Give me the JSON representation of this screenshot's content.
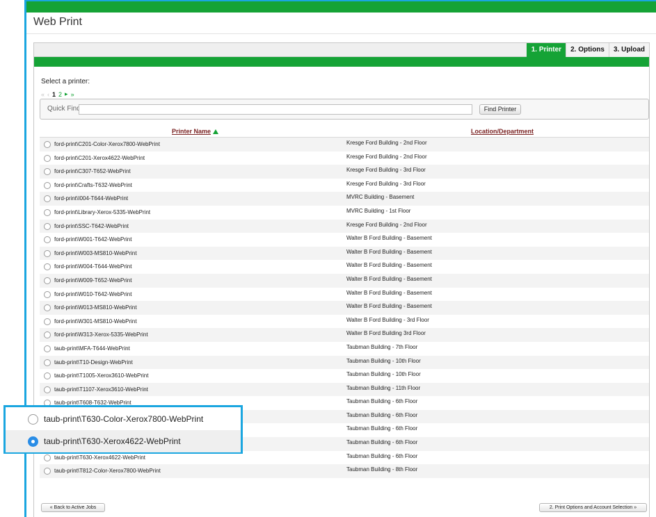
{
  "app": {
    "title": "Web Print"
  },
  "tabs": [
    {
      "label": "1. Printer",
      "active": true
    },
    {
      "label": "2. Options",
      "active": false
    },
    {
      "label": "3. Upload",
      "active": false
    }
  ],
  "select_label": "Select a printer:",
  "pager": {
    "first": "«",
    "prev": "‹",
    "current": "1",
    "next_page": "2",
    "next": "▸",
    "last": "»"
  },
  "quick_find": {
    "label": "Quick Find:",
    "value": "",
    "placeholder": "",
    "button": "Find Printer"
  },
  "table": {
    "columns": [
      "Printer Name",
      "Location/Department"
    ],
    "sort_column": "Printer Name",
    "rows": [
      {
        "name": "ford-print\\C201-Color-Xerox7800-WebPrint",
        "location": "Kresge Ford Building - 2nd Floor"
      },
      {
        "name": "ford-print\\C201-Xerox4622-WebPrint",
        "location": "Kresge Ford Building - 2nd Floor"
      },
      {
        "name": "ford-print\\C307-T652-WebPrint",
        "location": "Kresge Ford Building - 3rd Floor"
      },
      {
        "name": "ford-print\\Crafts-T632-WebPrint",
        "location": "Kresge Ford Building - 3rd Floor"
      },
      {
        "name": "ford-print\\I004-T644-WebPrint",
        "location": "MVRC Building - Basement"
      },
      {
        "name": "ford-print\\Library-Xerox-5335-WebPrint",
        "location": "MVRC Building - 1st Floor"
      },
      {
        "name": "ford-print\\SSC-T642-WebPrint",
        "location": "Kresge Ford Building - 2nd Floor"
      },
      {
        "name": "ford-print\\W001-T642-WebPrint",
        "location": "Walter B Ford Building - Basement"
      },
      {
        "name": "ford-print\\W003-MS810-WebPrint",
        "location": "Walter B Ford Building - Basement"
      },
      {
        "name": "ford-print\\W004-T644-WebPrint",
        "location": "Walter B Ford Building - Basement"
      },
      {
        "name": "ford-print\\W009-T652-WebPrint",
        "location": "Walter B Ford Building - Basement"
      },
      {
        "name": "ford-print\\W010-T642-WebPrint",
        "location": "Walter B Ford Building - Basement"
      },
      {
        "name": "ford-print\\W013-MS810-WebPrint",
        "location": "Walter B Ford Building - Basement"
      },
      {
        "name": "ford-print\\W301-MS810-WebPrint",
        "location": "Walter B Ford Building - 3rd Floor"
      },
      {
        "name": "ford-print\\W313-Xerox-5335-WebPrint",
        "location": "Walter B Ford Building 3rd Floor"
      },
      {
        "name": "taub-print\\MFA-T644-WebPrint",
        "location": "Taubman Building - 7th Floor"
      },
      {
        "name": "taub-print\\T10-Design-WebPrint",
        "location": "Taubman Building - 10th Floor"
      },
      {
        "name": "taub-print\\T1005-Xerox3610-WebPrint",
        "location": "Taubman Building - 10th Floor"
      },
      {
        "name": "taub-print\\T1107-Xerox3610-WebPrint",
        "location": "Taubman Building - 11th Floor"
      },
      {
        "name": "taub-print\\T608-T632-WebPrint",
        "location": "Taubman Building - 6th Floor"
      },
      {
        "name": "",
        "location": "Taubman Building - 6th Floor"
      },
      {
        "name": "",
        "location": "Taubman Building - 6th Floor"
      },
      {
        "name": "",
        "location": "Taubman Building - 6th Floor"
      },
      {
        "name": "taub-print\\T630-Xerox4622-WebPrint",
        "location": "Taubman Building - 6th Floor"
      },
      {
        "name": "taub-print\\T812-Color-Xerox7800-WebPrint",
        "location": "Taubman Building - 8th Floor"
      }
    ]
  },
  "zoom": {
    "items": [
      {
        "name": "taub-print\\T630-Color-Xerox7800-WebPrint",
        "selected": false
      },
      {
        "name": "taub-print\\T630-Xerox4622-WebPrint",
        "selected": true
      }
    ]
  },
  "footer": {
    "back": "« Back to Active Jobs",
    "next": "2. Print Options and Account Selection »"
  },
  "colors": {
    "brand_green": "#15a336",
    "highlight_blue": "#1aa6e0",
    "radio_checked": "#2a8de6",
    "header_link": "#7a2222"
  }
}
